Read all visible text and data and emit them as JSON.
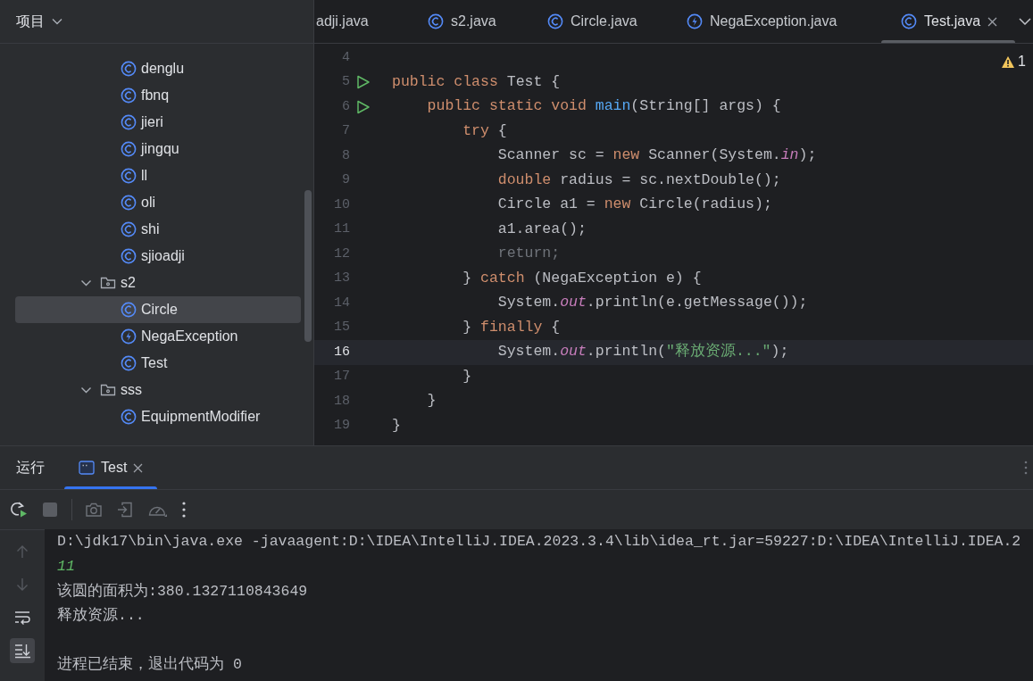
{
  "project_panel": {
    "title": "项目",
    "tree": [
      {
        "label": "denglu",
        "kind": "class",
        "selected": false
      },
      {
        "label": "fbnq",
        "kind": "class",
        "selected": false
      },
      {
        "label": "jieri",
        "kind": "class",
        "selected": false
      },
      {
        "label": "jingqu",
        "kind": "class",
        "selected": false
      },
      {
        "label": "ll",
        "kind": "class",
        "selected": false
      },
      {
        "label": "oli",
        "kind": "class",
        "selected": false
      },
      {
        "label": "shi",
        "kind": "class",
        "selected": false
      },
      {
        "label": "sjioadji",
        "kind": "class",
        "selected": false
      },
      {
        "label": "s2",
        "kind": "package",
        "selected": false,
        "expanded": true,
        "children": [
          {
            "label": "Circle",
            "kind": "class",
            "selected": true
          },
          {
            "label": "NegaException",
            "kind": "exception",
            "selected": false
          },
          {
            "label": "Test",
            "kind": "class",
            "selected": false
          }
        ]
      },
      {
        "label": "sss",
        "kind": "package",
        "selected": false,
        "expanded": true,
        "children": [
          {
            "label": "EquipmentModifier",
            "kind": "class",
            "selected": false
          }
        ]
      }
    ]
  },
  "editor": {
    "tabs": [
      {
        "label": "adji.java",
        "kind": "none",
        "selected": false
      },
      {
        "label": "s2.java",
        "kind": "class",
        "selected": false
      },
      {
        "label": "Circle.java",
        "kind": "class",
        "selected": false
      },
      {
        "label": "NegaException.java",
        "kind": "exception",
        "selected": false
      },
      {
        "label": "Test.java",
        "kind": "class",
        "selected": true
      }
    ],
    "warning_count": "1",
    "lines": [
      {
        "number": "4",
        "current": false,
        "run_marker": false
      },
      {
        "number": "5",
        "current": false,
        "run_marker": true,
        "tokens": [
          {
            "text": "public class",
            "kind": "keyword"
          },
          {
            "text": " Test {",
            "kind": "plain"
          }
        ]
      },
      {
        "number": "6",
        "current": false,
        "run_marker": true,
        "tokens": [
          {
            "text": "    public static void",
            "kind": "keyword"
          },
          {
            "text": " main",
            "kind": "function"
          },
          {
            "text": "(String[] args) {",
            "kind": "plain"
          }
        ]
      },
      {
        "number": "7",
        "current": false,
        "run_marker": false,
        "tokens": [
          {
            "text": "        try",
            "kind": "keyword"
          },
          {
            "text": " {",
            "kind": "plain"
          }
        ]
      },
      {
        "number": "8",
        "current": false,
        "run_marker": false,
        "tokens": [
          {
            "text": "            Scanner sc = ",
            "kind": "plain"
          },
          {
            "text": "new",
            "kind": "keyword"
          },
          {
            "text": " Scanner(System.",
            "kind": "plain"
          },
          {
            "text": "in",
            "kind": "static"
          },
          {
            "text": ");",
            "kind": "plain"
          }
        ]
      },
      {
        "number": "9",
        "current": false,
        "run_marker": false,
        "tokens": [
          {
            "text": "            double",
            "kind": "keyword"
          },
          {
            "text": " radius = sc.nextDouble();",
            "kind": "plain"
          }
        ]
      },
      {
        "number": "10",
        "current": false,
        "run_marker": false,
        "tokens": [
          {
            "text": "            Circle a1 = ",
            "kind": "plain"
          },
          {
            "text": "new",
            "kind": "keyword"
          },
          {
            "text": " Circle(radius);",
            "kind": "plain"
          }
        ]
      },
      {
        "number": "11",
        "current": false,
        "run_marker": false,
        "tokens": [
          {
            "text": "            a1.area();",
            "kind": "plain"
          }
        ]
      },
      {
        "number": "12",
        "current": false,
        "run_marker": false,
        "tokens": [
          {
            "text": "            return;",
            "kind": "unreachable"
          }
        ]
      },
      {
        "number": "13",
        "current": false,
        "run_marker": false,
        "tokens": [
          {
            "text": "        } ",
            "kind": "plain"
          },
          {
            "text": "catch",
            "kind": "keyword"
          },
          {
            "text": " (NegaException e) {",
            "kind": "plain"
          }
        ]
      },
      {
        "number": "14",
        "current": false,
        "run_marker": false,
        "tokens": [
          {
            "text": "            System.",
            "kind": "plain"
          },
          {
            "text": "out",
            "kind": "static"
          },
          {
            "text": ".println(e.getMessage());",
            "kind": "plain"
          }
        ]
      },
      {
        "number": "15",
        "current": false,
        "run_marker": false,
        "tokens": [
          {
            "text": "        } ",
            "kind": "plain"
          },
          {
            "text": "finally",
            "kind": "keyword"
          },
          {
            "text": " {",
            "kind": "plain"
          }
        ]
      },
      {
        "number": "16",
        "current": true,
        "run_marker": false,
        "tokens": [
          {
            "text": "            System.",
            "kind": "plain"
          },
          {
            "text": "out",
            "kind": "static"
          },
          {
            "text": ".println(",
            "kind": "plain"
          },
          {
            "text": "\"释放资源...\"",
            "kind": "string"
          },
          {
            "text": ");",
            "kind": "plain"
          }
        ]
      },
      {
        "number": "17",
        "current": false,
        "run_marker": false,
        "tokens": [
          {
            "text": "        }",
            "kind": "plain"
          }
        ]
      },
      {
        "number": "18",
        "current": false,
        "run_marker": false,
        "tokens": [
          {
            "text": "    }",
            "kind": "plain"
          }
        ]
      },
      {
        "number": "19",
        "current": false,
        "run_marker": false,
        "tokens": [
          {
            "text": "}",
            "kind": "plain"
          }
        ]
      }
    ]
  },
  "run_panel": {
    "title": "运行",
    "tabs": [
      {
        "label": "Test",
        "selected": true
      }
    ],
    "toolbar": [
      {
        "kind": "rerun",
        "disabled": false
      },
      {
        "kind": "stop",
        "disabled": true
      },
      {
        "kind": "separator"
      },
      {
        "kind": "screenshot",
        "disabled": true
      },
      {
        "kind": "exit",
        "disabled": true
      },
      {
        "kind": "profiler",
        "disabled": true
      },
      {
        "kind": "more",
        "disabled": false
      }
    ],
    "side_tools": [
      {
        "kind": "scroll_up",
        "disabled": true,
        "selected": false
      },
      {
        "kind": "scroll_down",
        "disabled": true,
        "selected": false
      },
      {
        "kind": "soft_wrap",
        "disabled": false,
        "selected": false
      },
      {
        "kind": "scroll_to_end",
        "disabled": false,
        "selected": true
      }
    ],
    "console": [
      {
        "text": "D:\\jdk17\\bin\\java.exe -javaagent:D:\\IDEA\\IntelliJ.IDEA.2023.3.4\\lib\\idea_rt.jar=59227:D:\\IDEA\\IntelliJ.IDEA.2",
        "kind": "system"
      },
      {
        "text": "11",
        "kind": "input"
      },
      {
        "text": "该圆的面积为:380.1327110843649",
        "kind": "output"
      },
      {
        "text": "释放资源...",
        "kind": "output"
      },
      {
        "kind": "blank"
      },
      {
        "text": "进程已结束，退出代码为 0",
        "kind": "output"
      }
    ]
  }
}
